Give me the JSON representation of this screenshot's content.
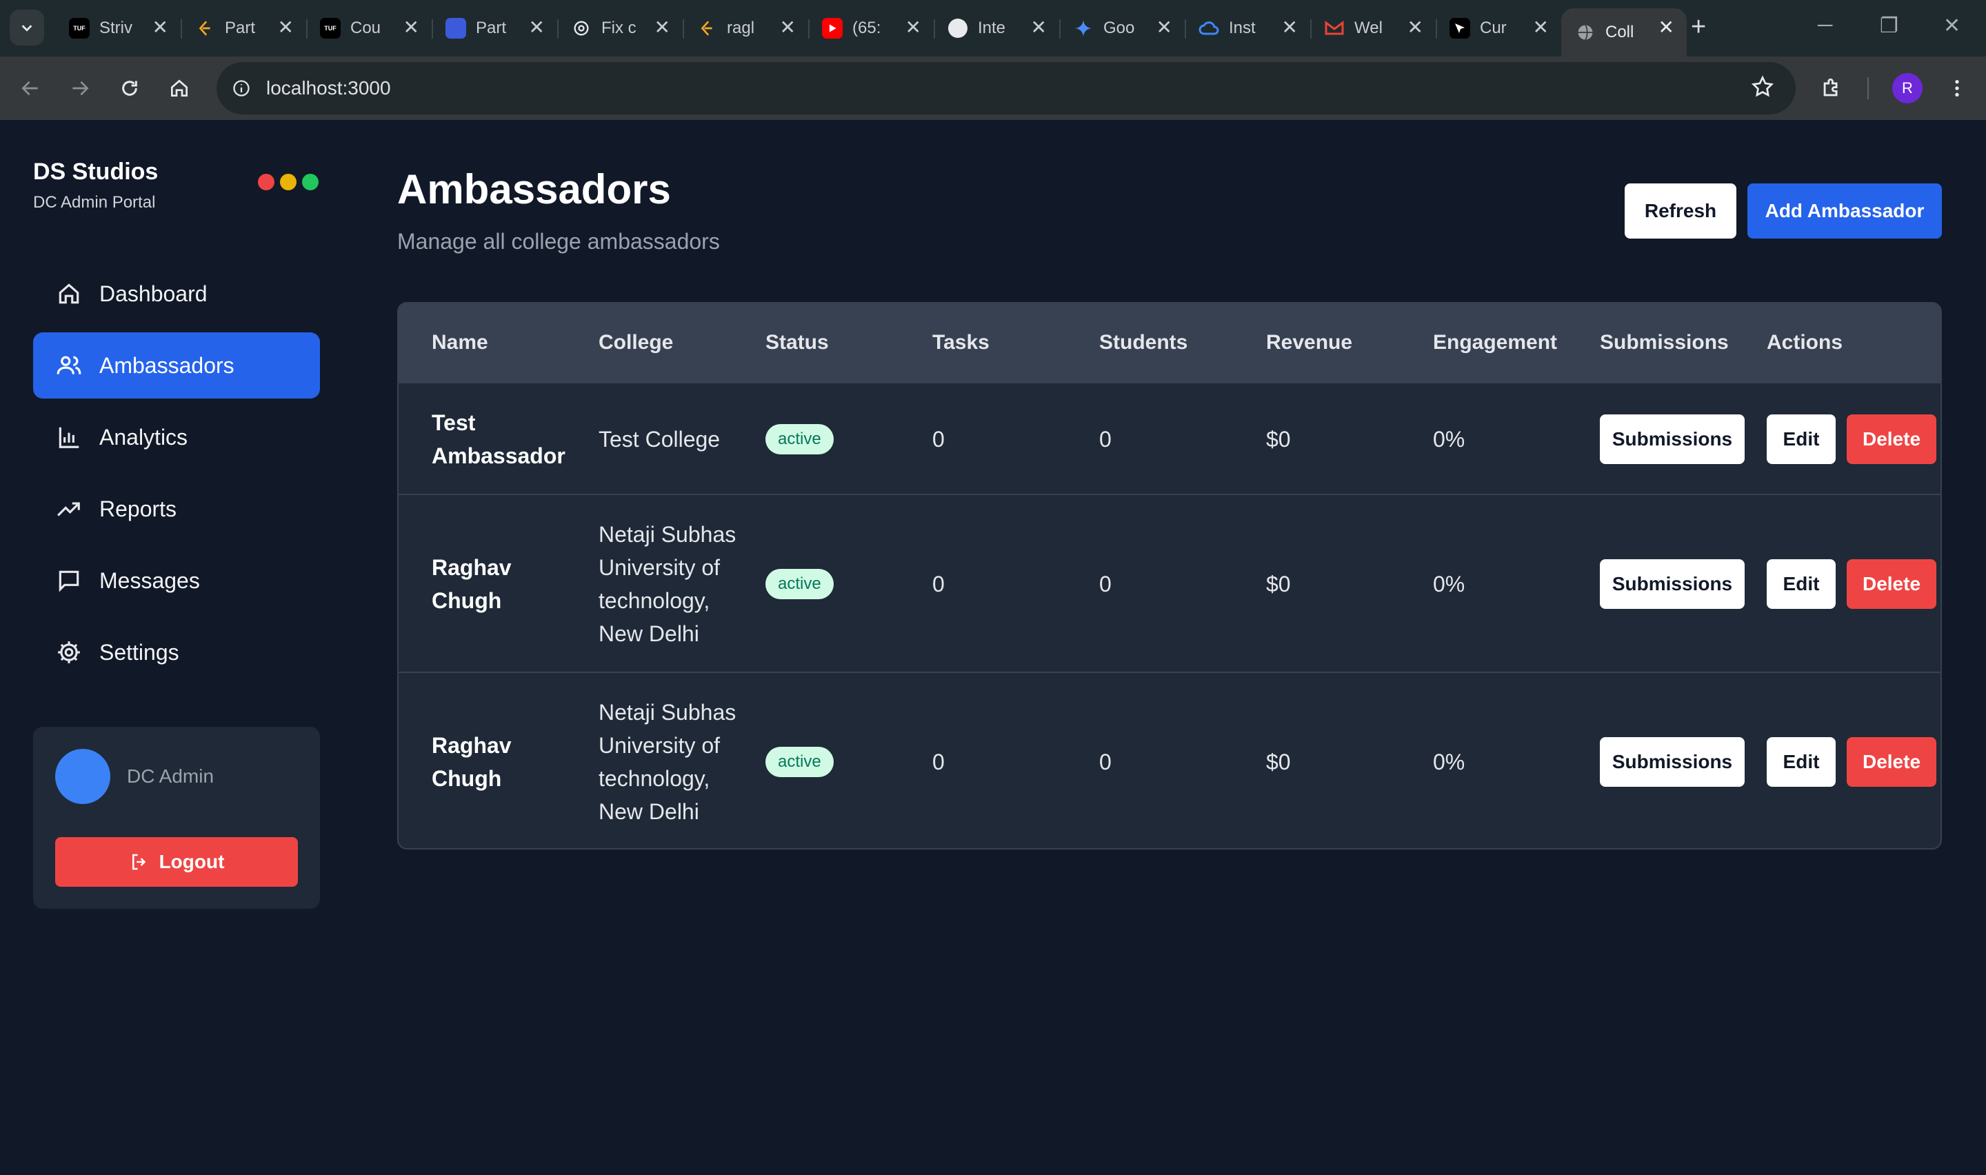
{
  "browser": {
    "tabs": [
      {
        "title": "Striv",
        "icon": "tuf-icon",
        "active": false
      },
      {
        "title": "Part",
        "icon": "leetcode-icon",
        "active": false
      },
      {
        "title": "Cou",
        "icon": "tuf-icon",
        "active": false
      },
      {
        "title": "Part",
        "icon": "clickup-icon",
        "active": false
      },
      {
        "title": "Fix c",
        "icon": "openai-icon",
        "active": false
      },
      {
        "title": "ragl",
        "icon": "leetcode-icon",
        "active": false
      },
      {
        "title": "(65:",
        "icon": "youtube-icon",
        "active": false
      },
      {
        "title": "Inte",
        "icon": "github-icon",
        "active": false
      },
      {
        "title": "Goo",
        "icon": "gemini-icon",
        "active": false
      },
      {
        "title": "Inst",
        "icon": "google-cloud-icon",
        "active": false
      },
      {
        "title": "Wel",
        "icon": "gmail-icon",
        "active": false
      },
      {
        "title": "Cur",
        "icon": "cursor-icon",
        "active": false
      },
      {
        "title": "Coll",
        "icon": "globe-icon",
        "active": true
      }
    ],
    "url": "localhost:3000",
    "profile_initial": "R"
  },
  "sidebar": {
    "brand": "DS Studios",
    "subtitle": "DC Admin Portal",
    "window_dots": [
      "#ef4444",
      "#eab308",
      "#22c55e"
    ],
    "items": [
      {
        "label": "Dashboard",
        "icon": "home-icon",
        "active": false
      },
      {
        "label": "Ambassadors",
        "icon": "users-icon",
        "active": true
      },
      {
        "label": "Analytics",
        "icon": "bar-chart-icon",
        "active": false
      },
      {
        "label": "Reports",
        "icon": "trending-up-icon",
        "active": false
      },
      {
        "label": "Messages",
        "icon": "message-square-icon",
        "active": false
      },
      {
        "label": "Settings",
        "icon": "gear-icon",
        "active": false
      }
    ],
    "user": {
      "name": "DC Admin"
    },
    "logout_label": "Logout"
  },
  "main": {
    "title": "Ambassadors",
    "subtitle": "Manage all college ambassadors",
    "refresh_label": "Refresh",
    "add_label": "Add Ambassador",
    "table": {
      "columns": [
        "Name",
        "College",
        "Status",
        "Tasks",
        "Students",
        "Revenue",
        "Engagement",
        "Submissions",
        "Actions"
      ],
      "rows": [
        {
          "name": [
            "Test",
            "Ambassador"
          ],
          "college": [
            "Test College"
          ],
          "status": "active",
          "tasks": "0",
          "students": "0",
          "revenue": "$0",
          "engagement": "0%"
        },
        {
          "name": [
            "Raghav",
            "Chugh"
          ],
          "college": [
            "Netaji Subhas",
            "University of",
            "technology,",
            "New Delhi"
          ],
          "status": "active",
          "tasks": "0",
          "students": "0",
          "revenue": "$0",
          "engagement": "0%"
        },
        {
          "name": [
            "Raghav",
            "Chugh"
          ],
          "college": [
            "Netaji Subhas",
            "University of",
            "technology,",
            "New Delhi"
          ],
          "status": "active",
          "tasks": "0",
          "students": "0",
          "revenue": "$0",
          "engagement": "0%"
        }
      ],
      "actions": {
        "submissions": "Submissions",
        "edit": "Edit",
        "delete": "Delete"
      }
    }
  },
  "colors": {
    "background": "#111827",
    "primary": "#2563eb",
    "danger": "#ef4444",
    "card": "#1f2937",
    "badge_bg": "#d1fae5",
    "badge_text": "#047857"
  }
}
